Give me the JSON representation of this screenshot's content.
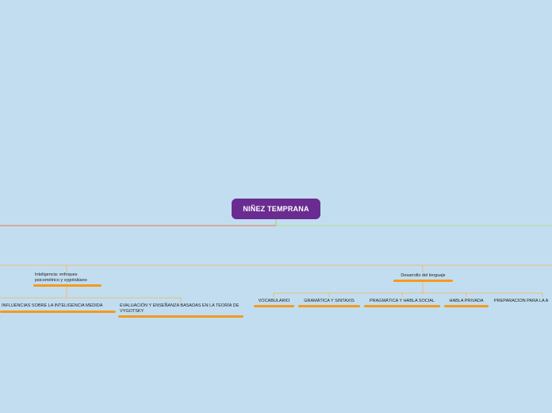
{
  "root": {
    "title": "NIÑEZ TEMPRANA"
  },
  "branches": {
    "intelligence": {
      "label": "Inteligencia: enfoques psicométrico y vygotskiano",
      "children": [
        "INFLUENCIAS SOBRE LA INTELIGENCIA MEDIDA",
        "EVALUACIÓN Y ENSEÑANZA BASADAS EN LA TEORÍA DE VYGOTSKY"
      ]
    },
    "language": {
      "label": "Desarrollo del lenguaje",
      "children": [
        "VOCABULARIO",
        "GRAMÁTICA Y SINTAXIS",
        "PRAGMÁTICA Y HABLA SOCIAL",
        "HABLA PRIVADA",
        "PREPARACIÓN PARA LA A"
      ]
    }
  },
  "colors": {
    "background": "#c3ddf0",
    "root_fill": "#6a2c91",
    "root_text": "#ffffff",
    "node_underline": "#f29b1d",
    "left_main_line": "#e8754d",
    "right_main_line": "#9be36a",
    "branch_line": "#f2b45a"
  }
}
